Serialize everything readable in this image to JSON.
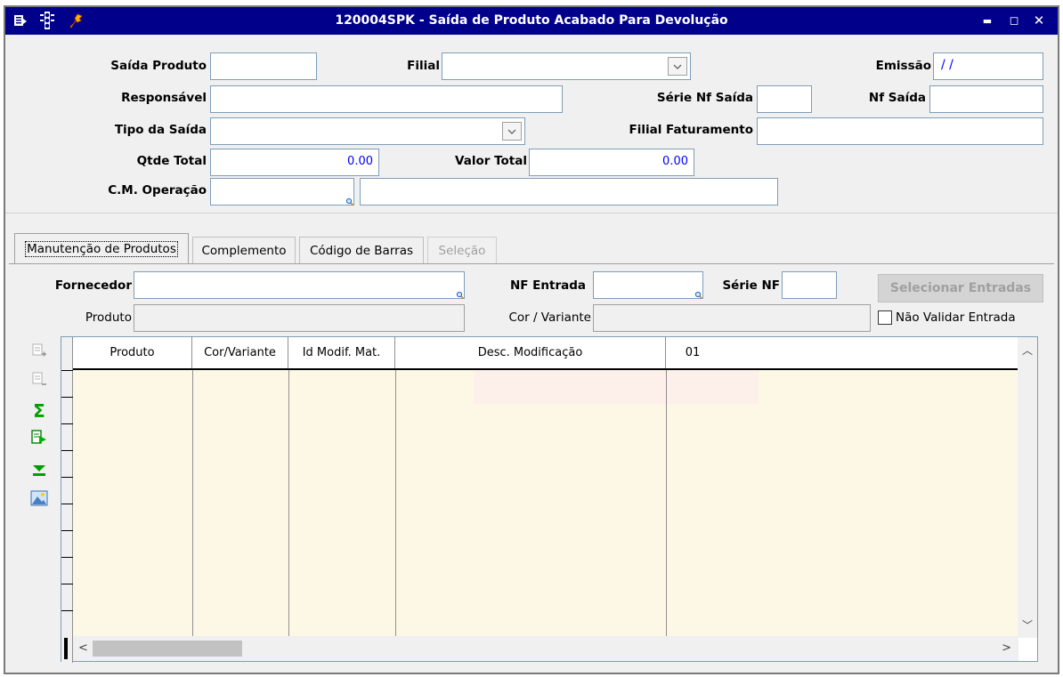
{
  "window": {
    "title": "120004SPK - Saída de Produto Acabado Para Devolução",
    "minimize": "▬",
    "maximize": "◻",
    "close": "✕"
  },
  "header": {
    "saida_produto": {
      "label": "Saída Produto",
      "value": ""
    },
    "filial": {
      "label": "Filial",
      "value": ""
    },
    "emissao": {
      "label": "Emissão",
      "value": " / /"
    },
    "responsavel": {
      "label": "Responsável",
      "value": ""
    },
    "serie_nf_saida": {
      "label": "Série Nf Saída",
      "value": ""
    },
    "nf_saida": {
      "label": "Nf Saída",
      "value": ""
    },
    "tipo_saida": {
      "label": "Tipo da Saída",
      "value": ""
    },
    "filial_faturamento": {
      "label": "Filial Faturamento",
      "value": ""
    },
    "qtde_total": {
      "label": "Qtde Total",
      "value": "0.00"
    },
    "valor_total": {
      "label": "Valor Total",
      "value": "0.00"
    },
    "cm_operacao": {
      "label": "C.M. Operação",
      "value": ""
    }
  },
  "tabs": [
    {
      "label": "Manutenção de Produtos",
      "state": "active"
    },
    {
      "label": "Complemento",
      "state": "normal"
    },
    {
      "label": "Código de Barras",
      "state": "normal"
    },
    {
      "label": "Seleção",
      "state": "disabled"
    }
  ],
  "maintenance": {
    "fornecedor": {
      "label": "Fornecedor",
      "value": ""
    },
    "nf_entrada": {
      "label": "NF Entrada",
      "value": ""
    },
    "serie_nf": {
      "label": "Série NF",
      "value": ""
    },
    "selecionar_entradas": "Selecionar Entradas",
    "produto": {
      "label": "Produto",
      "value": ""
    },
    "cor_variante": {
      "label": "Cor / Variante",
      "value": ""
    },
    "nao_validar": "Não Validar Entrada"
  },
  "grid": {
    "columns": [
      "Produto",
      "Cor/Variante",
      "Id Modif. Mat.",
      "Desc. Modificação",
      "01"
    ]
  },
  "icons": {
    "app": "list-icon",
    "traffic": "traffic-light-icon",
    "tools": "wrench-icon",
    "add_row": "add-row-icon",
    "remove_row": "remove-row-icon",
    "sum": "sum-icon",
    "export": "export-icon",
    "goto_end": "goto-end-icon",
    "image": "image-icon"
  }
}
